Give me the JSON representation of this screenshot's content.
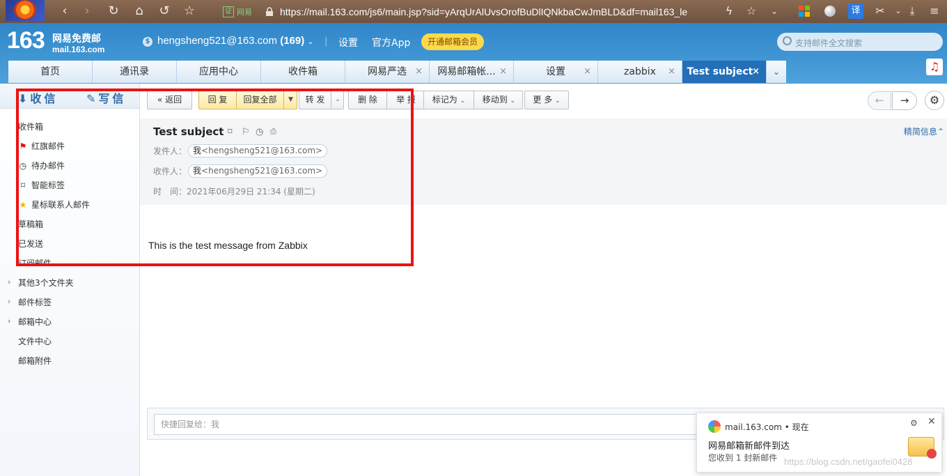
{
  "browser": {
    "back": "‹",
    "forward": "›",
    "reload": "↻",
    "home": "⌂",
    "undo": "↺",
    "star": "☆",
    "secure_label": "网易",
    "url": "https://mail.163.com/js6/main.jsp?sid=yArqUrAlUvsOrofBuDlIQNkbaCwJmBLD&df=mail163_le",
    "icons": [
      "bolt-icon",
      "bookmark-star-icon",
      "chevron-down-icon",
      "apps-icon",
      "globe-icon",
      "translate-icon",
      "scissors-icon",
      "download-icon",
      "menu-icon"
    ],
    "translate": "译"
  },
  "header": {
    "logo_num": "163",
    "logo_name": "网易免费邮",
    "logo_domain": "mail.163.com",
    "account": "hengsheng521@163.com",
    "unread": "(169)",
    "settings": "设置",
    "app": "官方App",
    "vip": "开通邮箱会员",
    "search_placeholder": "支持邮件全文搜索"
  },
  "tabs": [
    {
      "label": "首页",
      "close": ""
    },
    {
      "label": "通讯录",
      "close": ""
    },
    {
      "label": "应用中心",
      "close": ""
    },
    {
      "label": "收件箱",
      "close": ""
    },
    {
      "label": "网易严选",
      "close": "×"
    },
    {
      "label": "网易邮箱帐...",
      "close": "×"
    },
    {
      "label": "设置",
      "close": "×"
    },
    {
      "label": "zabbix",
      "close": "×"
    },
    {
      "label": "Test subject",
      "close": "×"
    }
  ],
  "sidebar": {
    "receive": "收信",
    "write": "写信",
    "items": [
      {
        "label": "收件箱"
      },
      {
        "label": "红旗邮件"
      },
      {
        "label": "待办邮件"
      },
      {
        "label": "智能标签"
      },
      {
        "label": "星标联系人邮件"
      },
      {
        "label": "草稿箱"
      },
      {
        "label": "已发送"
      },
      {
        "label": "订阅邮件"
      },
      {
        "label": "其他3个文件夹"
      },
      {
        "label": "邮件标签"
      },
      {
        "label": "邮箱中心"
      },
      {
        "label": "文件中心"
      },
      {
        "label": "邮箱附件"
      }
    ]
  },
  "toolbar": {
    "back": "返回",
    "reply": "回 复",
    "reply_all": "回复全部",
    "forward": "转 发",
    "delete": "删 除",
    "report": "举 报",
    "mark_as": "标记为",
    "move_to": "移动到",
    "more": "更 多"
  },
  "message": {
    "subject": "Test subject",
    "from_label": "发件人：",
    "from_name": "我",
    "from_addr": "<hengsheng521@163.com>",
    "to_label": "收件人：",
    "to_name": "我",
    "to_addr": "<hengsheng521@163.com>",
    "time_label": "时　间：",
    "time_value": "2021年06月29日 21:34 (星期二)",
    "detail_link": "精简信息",
    "body": "This is the test message from Zabbix"
  },
  "quick_reply": {
    "placeholder": "快捷回复给：我"
  },
  "toast": {
    "source": "mail.163.com",
    "time": "现在",
    "title": "网易邮箱新邮件到达",
    "message": "您收到 1 封新邮件"
  },
  "watermark": "https://blog.csdn.net/gaofei0428",
  "colors": {
    "header": "#2f86c8",
    "active_tab": "#246fb8",
    "highlight_frame": "#ee1111",
    "vip": "#ffd94a"
  }
}
